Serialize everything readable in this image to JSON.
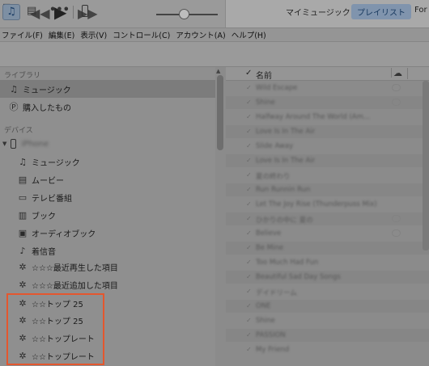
{
  "menu": [
    "ファイル(F)",
    "編集(E)",
    "表示(V)",
    "コントロール(C)",
    "アカウント(A)",
    "ヘルプ(H)"
  ],
  "toolbar": {
    "music_icon": "♫",
    "movie_icon": "▤",
    "more_icon": "•••",
    "tab_my_music": "マイミュージック",
    "tab_playlist": "プレイリスト",
    "tab_more": "For"
  },
  "transport": {
    "prev": "◀◀",
    "play": "▶",
    "next": "▶▶"
  },
  "sidebar": {
    "library_header": "ライブラリ",
    "library": [
      {
        "icon": "♫",
        "label": "ミュージック"
      },
      {
        "icon": "Ⓟ",
        "label": "購入したもの"
      }
    ],
    "devices_header": "デバイス",
    "device_name": "iPhone",
    "device_items": [
      {
        "icon": "♫",
        "label": "ミュージック"
      },
      {
        "icon": "▤",
        "label": "ムービー"
      },
      {
        "icon": "▭",
        "label": "テレビ番組"
      },
      {
        "icon": "▥",
        "label": "ブック"
      },
      {
        "icon": "▣",
        "label": "オーディオブック"
      },
      {
        "icon": "♪",
        "label": "着信音"
      },
      {
        "icon": "✲",
        "label": "☆☆☆最近再生した項目"
      },
      {
        "icon": "✲",
        "label": "☆☆☆最近追加した項目"
      },
      {
        "icon": "✲",
        "label": "☆☆トップ 25"
      },
      {
        "icon": "✲",
        "label": "☆☆トップ 25"
      },
      {
        "icon": "✲",
        "label": "☆☆トップレート"
      },
      {
        "icon": "✲",
        "label": "☆☆トップレート"
      }
    ]
  },
  "list": {
    "header_check": "✓",
    "header_name": "名前",
    "header_cloud": "☁",
    "rows": [
      {
        "name": "Wild Escape"
      },
      {
        "name": "Shine"
      },
      {
        "name": "Halfway Around The World (Am..."
      },
      {
        "name": "Love Is In The Air"
      },
      {
        "name": "Slide Away"
      },
      {
        "name": "Love Is In The Air"
      },
      {
        "name": "夏の終わり"
      },
      {
        "name": "Run Runnin Run"
      },
      {
        "name": "Let The Joy Rise (Thunderpuss Mix)"
      },
      {
        "name": "ひかりの中に 夏の"
      },
      {
        "name": "Believe"
      },
      {
        "name": "Be Mine"
      },
      {
        "name": "Too Much Had Fun"
      },
      {
        "name": "Beautiful Sad Day Songs"
      },
      {
        "name": "デイドリーム"
      },
      {
        "name": "ONE"
      },
      {
        "name": "Shine"
      },
      {
        "name": "PASSION"
      },
      {
        "name": "My Friend"
      }
    ]
  }
}
